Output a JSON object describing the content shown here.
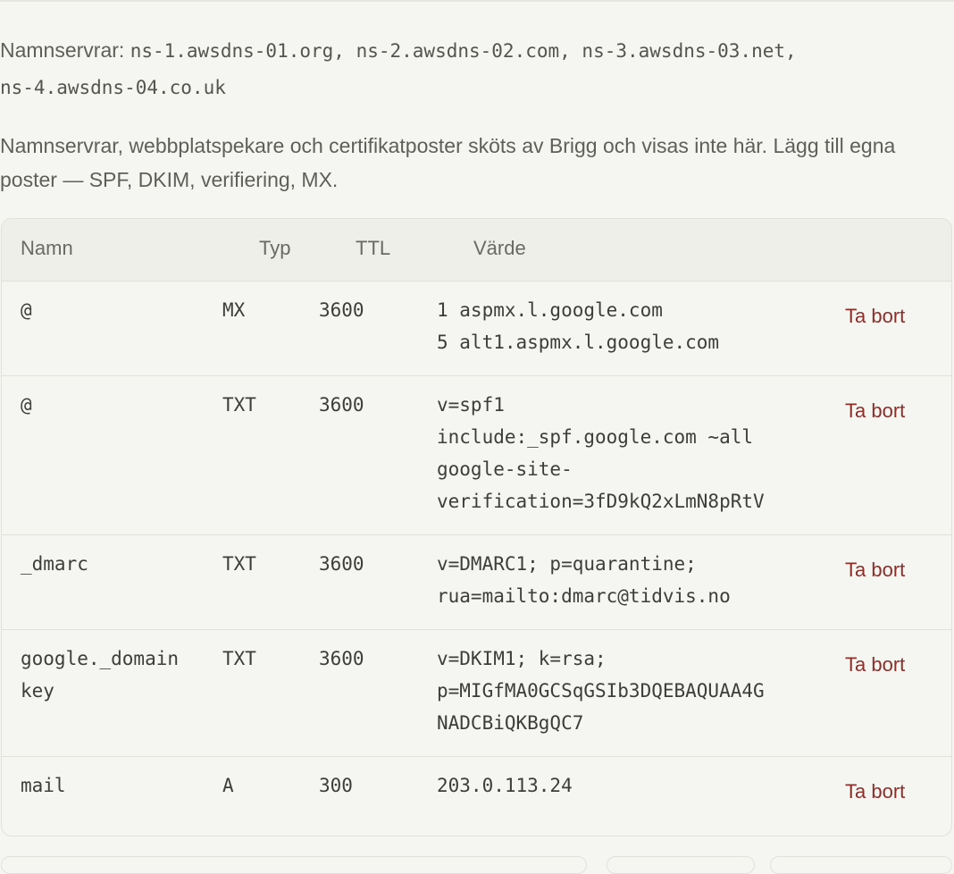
{
  "nameservers": {
    "label": "Namnservrar:",
    "values": "ns-1.awsdns-01.org, ns-2.awsdns-02.com, ns-3.awsdns-03.net,\nns-4.awsdns-04.co.uk"
  },
  "description": "Namnservrar, webbplatspekare och certifikatposter sköts av Brigg och visas inte här. Lägg till egna poster — SPF, DKIM, verifiering, MX.",
  "table": {
    "headers": {
      "name": "Namn",
      "type": "Typ",
      "ttl": "TTL",
      "value": "Värde"
    },
    "delete_label": "Ta bort",
    "rows": [
      {
        "name": "@",
        "type": "MX",
        "ttl": "3600",
        "value": "1 aspmx.l.google.com\n5 alt1.aspmx.l.google.com"
      },
      {
        "name": "@",
        "type": "TXT",
        "ttl": "3600",
        "value": "v=spf1\ninclude:_spf.google.com ~all\ngoogle-site-\nverification=3fD9kQ2xLmN8pRtV"
      },
      {
        "name": "_dmarc",
        "type": "TXT",
        "ttl": "3600",
        "value": "v=DMARC1; p=quarantine;\nrua=mailto:dmarc@tidvis.no"
      },
      {
        "name": "google._domain\nkey",
        "type": "TXT",
        "ttl": "3600",
        "value": "v=DKIM1; k=rsa;\np=MIGfMA0GCSqGSIb3DQEBAQUAA4G\nNADCBiQKBgQC7"
      },
      {
        "name": "mail",
        "type": "A",
        "ttl": "300",
        "value": "203.0.113.24"
      }
    ]
  }
}
